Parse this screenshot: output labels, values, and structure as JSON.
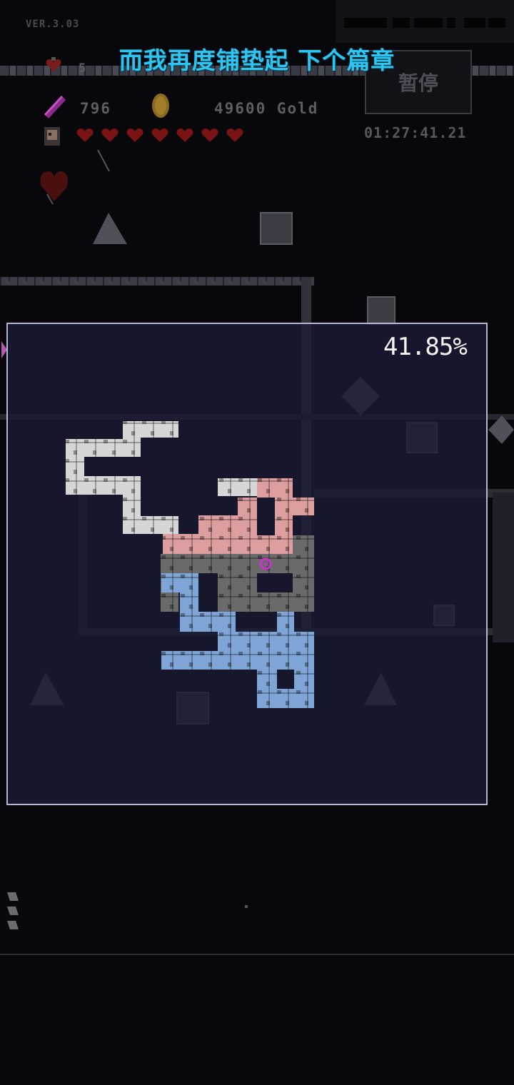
{
  "hud": {
    "version": "VER.3.03",
    "subtitle": "而我再度铺垫起 下个篇章",
    "lives": "5",
    "crystals": "796",
    "gold": "49600 Gold",
    "pause_label": "暂停",
    "timer": "01:27:41.21",
    "hearts_full": 7
  },
  "minimap": {
    "explored_percent": "41.85%",
    "colors": {
      "white_zone": "#d6d6d6",
      "pink_zone": "#dc9e9e",
      "gray_zone": "#6a6a6a",
      "blue_zone": "#7ea5d6",
      "player_marker": "#cc33cc",
      "panel_border": "#b4b8d2"
    }
  },
  "icons": {
    "lives": "heart-potion-icon",
    "crystal": "crystal-icon",
    "gold": "gold-coin-icon",
    "character": "character-portrait-icon",
    "heart": "heart-icon"
  }
}
